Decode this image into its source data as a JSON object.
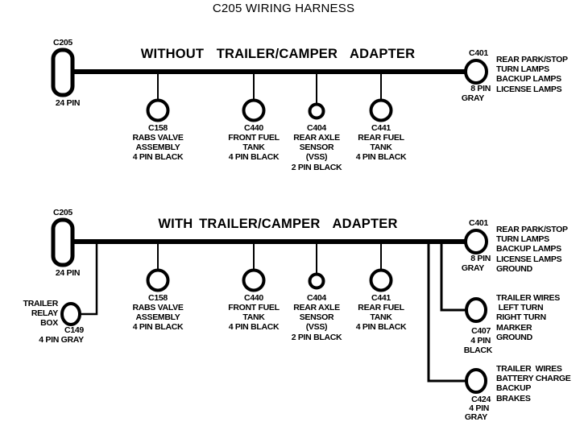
{
  "title": "C205 WIRING HARNESS",
  "sections": [
    {
      "heading": "WITHOUT  TRAILER/CAMPER  ADAPTER",
      "source": {
        "id": "C205",
        "pins": "24 PIN"
      },
      "terminus": {
        "id": "C401",
        "pins": "8 PIN",
        "color": "GRAY",
        "circuits": [
          "REAR PARK/STOP",
          "TURN LAMPS",
          "BACKUP LAMPS",
          "LICENSE LAMPS"
        ]
      },
      "drops": [
        {
          "id": "C158",
          "lines": [
            "RABS VALVE",
            "ASSEMBLY",
            "4 PIN BLACK"
          ]
        },
        {
          "id": "C440",
          "lines": [
            "FRONT FUEL",
            "TANK",
            "4 PIN BLACK"
          ]
        },
        {
          "id": "C404",
          "lines": [
            "REAR AXLE",
            "SENSOR",
            "(VSS)",
            "2 PIN BLACK"
          ]
        },
        {
          "id": "C441",
          "lines": [
            "REAR FUEL",
            "TANK",
            "4 PIN BLACK"
          ]
        }
      ]
    },
    {
      "heading": "WITH TRAILER/CAMPER  ADAPTER",
      "source": {
        "id": "C205",
        "pins": "24 PIN"
      },
      "relay_box": {
        "name_lines": [
          "TRAILER",
          "RELAY",
          "BOX"
        ],
        "id": "C149",
        "spec": "4 PIN GRAY"
      },
      "terminus": {
        "id": "C401",
        "pins": "8 PIN",
        "color": "GRAY",
        "circuits": [
          "REAR PARK/STOP",
          "TURN LAMPS",
          "BACKUP LAMPS",
          "LICENSE LAMPS",
          "GROUND"
        ]
      },
      "drops": [
        {
          "id": "C158",
          "lines": [
            "RABS VALVE",
            "ASSEMBLY",
            "4 PIN BLACK"
          ]
        },
        {
          "id": "C440",
          "lines": [
            "FRONT FUEL",
            "TANK",
            "4 PIN BLACK"
          ]
        },
        {
          "id": "C404",
          "lines": [
            "REAR AXLE",
            "SENSOR",
            "(VSS)",
            "2 PIN BLACK"
          ]
        },
        {
          "id": "C441",
          "lines": [
            "REAR FUEL",
            "TANK",
            "4 PIN BLACK"
          ]
        }
      ],
      "branches": [
        {
          "id": "C407",
          "pins": "4 PIN",
          "color": "BLACK",
          "circuits": [
            "TRAILER WIRES",
            " LEFT TURN",
            "RIGHT TURN",
            "MARKER",
            "GROUND"
          ]
        },
        {
          "id": "C424",
          "pins": "4 PIN",
          "color": "GRAY",
          "circuits": [
            "TRAILER  WIRES",
            "BATTERY CHARGE",
            "BACKUP",
            "BRAKES"
          ]
        }
      ]
    }
  ],
  "colors": {
    "ink": "#000000",
    "background": "#ffffff"
  }
}
